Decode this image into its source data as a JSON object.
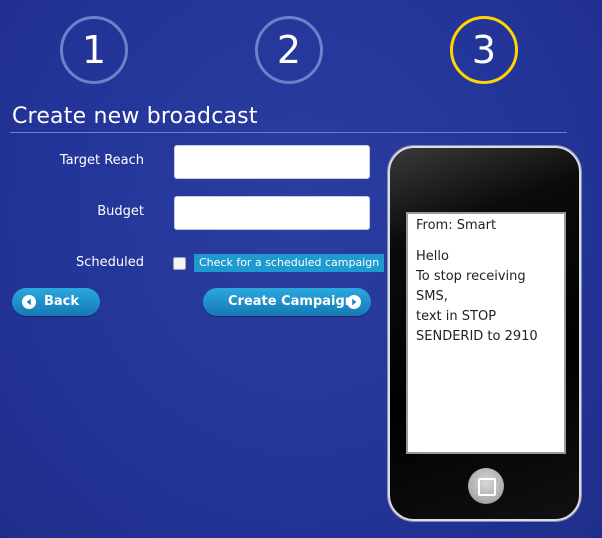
{
  "steps": [
    {
      "label": "1",
      "state": "inactive"
    },
    {
      "label": "2",
      "state": "inactive"
    },
    {
      "label": "3",
      "state": "active"
    }
  ],
  "colors": {
    "background": "#24359a",
    "step_ring": "#6f7fc8",
    "step_active_ring": "#ffd400",
    "button": "#1f8fc8",
    "hint_bg": "#1f9ad0"
  },
  "page": {
    "title": "Create new broadcast"
  },
  "form": {
    "target_reach": {
      "label": "Target Reach",
      "value": "",
      "placeholder": ""
    },
    "budget": {
      "label": "Budget",
      "value": "",
      "placeholder": ""
    },
    "scheduled": {
      "label": "Scheduled",
      "checked": false,
      "hint": "Check for a scheduled campaign"
    }
  },
  "buttons": {
    "back": {
      "label": "Back",
      "icon": "arrow-left-circle-icon"
    },
    "create": {
      "label": "Create Campaign",
      "icon": "arrow-right-circle-icon"
    }
  },
  "phone_preview": {
    "from": "From: Smart",
    "message_lines": [
      "Hello",
      "To stop receiving SMS,",
      "text in STOP",
      "SENDERID to 2910"
    ],
    "home_icon": "home-button-icon"
  }
}
